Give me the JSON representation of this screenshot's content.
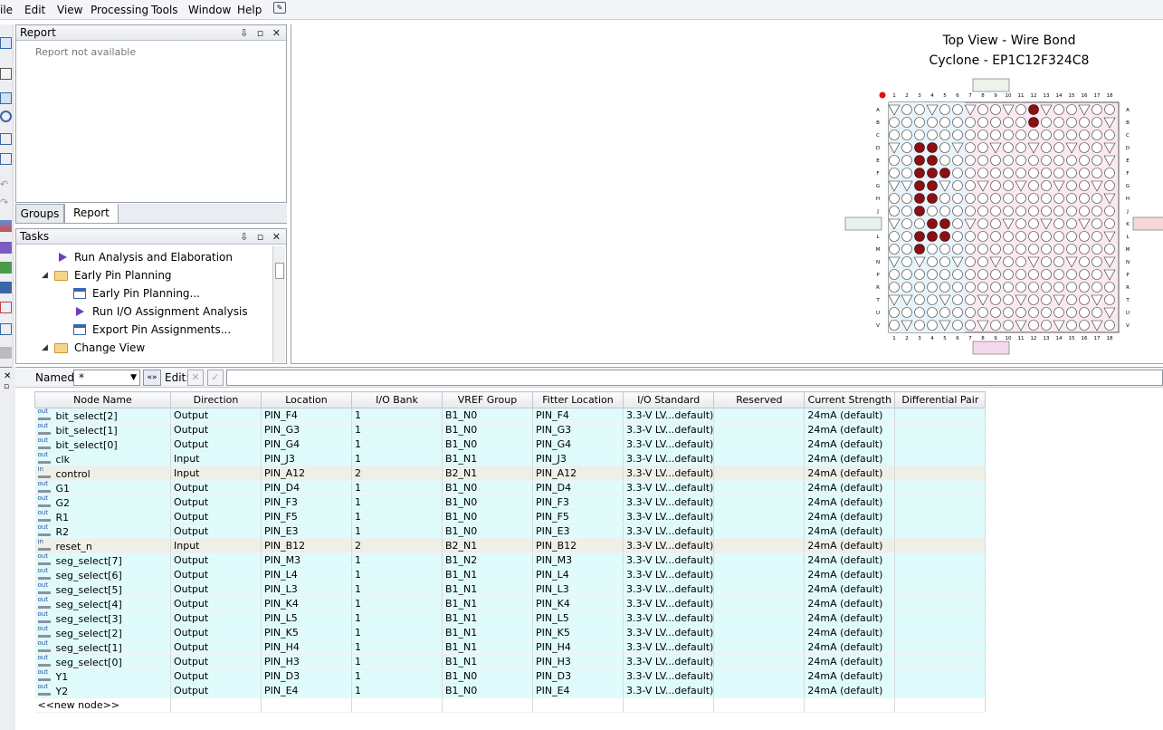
{
  "menu": [
    "ile",
    "Edit",
    "View",
    "Processing",
    "Tools",
    "Window",
    "Help"
  ],
  "report_panel": {
    "title": "Report",
    "message": "Report not available",
    "controls": "⇩ ▫ ✕"
  },
  "tabs": [
    "Groups",
    "Report"
  ],
  "tasks_panel": {
    "title": "Tasks",
    "items": [
      {
        "label": "Run Analysis and Elaboration",
        "icon": "run-icon"
      },
      {
        "label": "Early Pin Planning",
        "icon": "folder-icon"
      },
      {
        "label": "Early Pin Planning...",
        "icon": "window-icon"
      },
      {
        "label": "Run I/O Assignment Analysis",
        "icon": "run-icon"
      },
      {
        "label": "Export Pin Assignments...",
        "icon": "window-icon"
      },
      {
        "label": "Change View",
        "icon": "folder-icon"
      }
    ]
  },
  "chip_view": {
    "title_line1": "Top View - Wire Bond",
    "title_line2": "Cyclone - EP1C12F324C8",
    "rows": [
      "A",
      "B",
      "C",
      "D",
      "E",
      "F",
      "G",
      "H",
      "J",
      "K",
      "L",
      "M",
      "N",
      "P",
      "R",
      "T",
      "U",
      "V"
    ],
    "cols": [
      "1",
      "2",
      "3",
      "4",
      "5",
      "6",
      "7",
      "8",
      "9",
      "10",
      "11",
      "12",
      "13",
      "14",
      "15",
      "16",
      "17",
      "18"
    ]
  },
  "filter": {
    "named_label": "Named:",
    "named_value": "*",
    "edit_label": "Edit:"
  },
  "table": {
    "headers": [
      "Node Name",
      "Direction",
      "Location",
      "I/O Bank",
      "VREF Group",
      "Fitter Location",
      "I/O Standard",
      "Reserved",
      "Current Strength",
      "Differential Pair"
    ],
    "rows": [
      {
        "type": "out",
        "icon": "out",
        "node": "bit_select[2]",
        "dir": "Output",
        "loc": "PIN_F4",
        "bank": "1",
        "vref": "B1_N0",
        "fit": "PIN_F4",
        "std": "3.3-V LV...default)",
        "res": "",
        "cur": "24mA (default)",
        "diff": ""
      },
      {
        "type": "out",
        "icon": "out",
        "node": "bit_select[1]",
        "dir": "Output",
        "loc": "PIN_G3",
        "bank": "1",
        "vref": "B1_N0",
        "fit": "PIN_G3",
        "std": "3.3-V LV...default)",
        "res": "",
        "cur": "24mA (default)",
        "diff": ""
      },
      {
        "type": "out",
        "icon": "out",
        "node": "bit_select[0]",
        "dir": "Output",
        "loc": "PIN_G4",
        "bank": "1",
        "vref": "B1_N0",
        "fit": "PIN_G4",
        "std": "3.3-V LV...default)",
        "res": "",
        "cur": "24mA (default)",
        "diff": ""
      },
      {
        "type": "out",
        "icon": "out",
        "node": "clk",
        "dir": "Input",
        "loc": "PIN_J3",
        "bank": "1",
        "vref": "B1_N1",
        "fit": "PIN_J3",
        "std": "3.3-V LV...default)",
        "res": "",
        "cur": "24mA (default)",
        "diff": ""
      },
      {
        "type": "in",
        "icon": "in",
        "node": "control",
        "dir": "Input",
        "loc": "PIN_A12",
        "bank": "2",
        "vref": "B2_N1",
        "fit": "PIN_A12",
        "std": "3.3-V LV...default)",
        "res": "",
        "cur": "24mA (default)",
        "diff": ""
      },
      {
        "type": "out",
        "icon": "out",
        "node": "G1",
        "dir": "Output",
        "loc": "PIN_D4",
        "bank": "1",
        "vref": "B1_N0",
        "fit": "PIN_D4",
        "std": "3.3-V LV...default)",
        "res": "",
        "cur": "24mA (default)",
        "diff": ""
      },
      {
        "type": "out",
        "icon": "out",
        "node": "G2",
        "dir": "Output",
        "loc": "PIN_F3",
        "bank": "1",
        "vref": "B1_N0",
        "fit": "PIN_F3",
        "std": "3.3-V LV...default)",
        "res": "",
        "cur": "24mA (default)",
        "diff": ""
      },
      {
        "type": "out",
        "icon": "out",
        "node": "R1",
        "dir": "Output",
        "loc": "PIN_F5",
        "bank": "1",
        "vref": "B1_N0",
        "fit": "PIN_F5",
        "std": "3.3-V LV...default)",
        "res": "",
        "cur": "24mA (default)",
        "diff": ""
      },
      {
        "type": "out",
        "icon": "out",
        "node": "R2",
        "dir": "Output",
        "loc": "PIN_E3",
        "bank": "1",
        "vref": "B1_N0",
        "fit": "PIN_E3",
        "std": "3.3-V LV...default)",
        "res": "",
        "cur": "24mA (default)",
        "diff": ""
      },
      {
        "type": "in",
        "icon": "in",
        "node": "reset_n",
        "dir": "Input",
        "loc": "PIN_B12",
        "bank": "2",
        "vref": "B2_N1",
        "fit": "PIN_B12",
        "std": "3.3-V LV...default)",
        "res": "",
        "cur": "24mA (default)",
        "diff": ""
      },
      {
        "type": "out",
        "icon": "out",
        "node": "seg_select[7]",
        "dir": "Output",
        "loc": "PIN_M3",
        "bank": "1",
        "vref": "B1_N2",
        "fit": "PIN_M3",
        "std": "3.3-V LV...default)",
        "res": "",
        "cur": "24mA (default)",
        "diff": ""
      },
      {
        "type": "out",
        "icon": "out",
        "node": "seg_select[6]",
        "dir": "Output",
        "loc": "PIN_L4",
        "bank": "1",
        "vref": "B1_N1",
        "fit": "PIN_L4",
        "std": "3.3-V LV...default)",
        "res": "",
        "cur": "24mA (default)",
        "diff": ""
      },
      {
        "type": "out",
        "icon": "out",
        "node": "seg_select[5]",
        "dir": "Output",
        "loc": "PIN_L3",
        "bank": "1",
        "vref": "B1_N1",
        "fit": "PIN_L3",
        "std": "3.3-V LV...default)",
        "res": "",
        "cur": "24mA (default)",
        "diff": ""
      },
      {
        "type": "out",
        "icon": "out",
        "node": "seg_select[4]",
        "dir": "Output",
        "loc": "PIN_K4",
        "bank": "1",
        "vref": "B1_N1",
        "fit": "PIN_K4",
        "std": "3.3-V LV...default)",
        "res": "",
        "cur": "24mA (default)",
        "diff": ""
      },
      {
        "type": "out",
        "icon": "out",
        "node": "seg_select[3]",
        "dir": "Output",
        "loc": "PIN_L5",
        "bank": "1",
        "vref": "B1_N1",
        "fit": "PIN_L5",
        "std": "3.3-V LV...default)",
        "res": "",
        "cur": "24mA (default)",
        "diff": ""
      },
      {
        "type": "out",
        "icon": "out",
        "node": "seg_select[2]",
        "dir": "Output",
        "loc": "PIN_K5",
        "bank": "1",
        "vref": "B1_N1",
        "fit": "PIN_K5",
        "std": "3.3-V LV...default)",
        "res": "",
        "cur": "24mA (default)",
        "diff": ""
      },
      {
        "type": "out",
        "icon": "out",
        "node": "seg_select[1]",
        "dir": "Output",
        "loc": "PIN_H4",
        "bank": "1",
        "vref": "B1_N1",
        "fit": "PIN_H4",
        "std": "3.3-V LV...default)",
        "res": "",
        "cur": "24mA (default)",
        "diff": ""
      },
      {
        "type": "out",
        "icon": "out",
        "node": "seg_select[0]",
        "dir": "Output",
        "loc": "PIN_H3",
        "bank": "1",
        "vref": "B1_N1",
        "fit": "PIN_H3",
        "std": "3.3-V LV...default)",
        "res": "",
        "cur": "24mA (default)",
        "diff": ""
      },
      {
        "type": "out",
        "icon": "out",
        "node": "Y1",
        "dir": "Output",
        "loc": "PIN_D3",
        "bank": "1",
        "vref": "B1_N0",
        "fit": "PIN_D3",
        "std": "3.3-V LV...default)",
        "res": "",
        "cur": "24mA (default)",
        "diff": ""
      },
      {
        "type": "out",
        "icon": "out",
        "node": "Y2",
        "dir": "Output",
        "loc": "PIN_E4",
        "bank": "1",
        "vref": "B1_N0",
        "fit": "PIN_E4",
        "std": "3.3-V LV...default)",
        "res": "",
        "cur": "24mA (default)",
        "diff": ""
      }
    ],
    "new_node": "<<new node>>"
  }
}
